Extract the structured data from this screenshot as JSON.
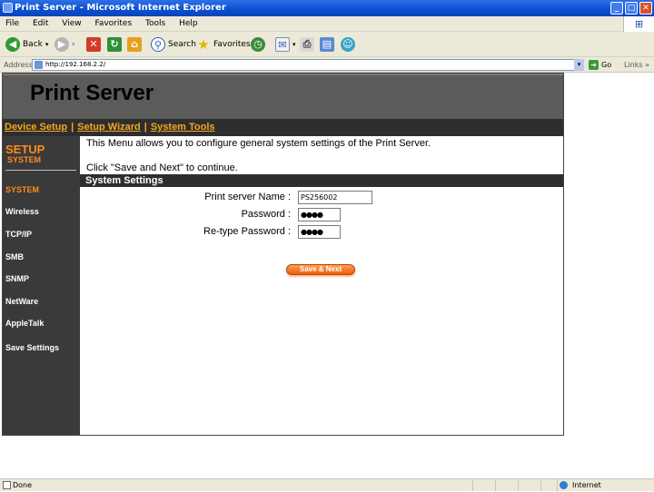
{
  "window": {
    "title": "Print Server - Microsoft Internet Explorer",
    "min": "_",
    "max": "□",
    "close": "✕"
  },
  "menu": [
    "File",
    "Edit",
    "View",
    "Favorites",
    "Tools",
    "Help"
  ],
  "toolbar": {
    "back": "Back",
    "search": "Search",
    "favorites": "Favorites"
  },
  "address": {
    "label": "Address",
    "url": "http://192.168.2.2/",
    "go": "Go",
    "links": "Links"
  },
  "page": {
    "title": "Print Server",
    "nav": [
      "Device Setup",
      "Setup Wizard",
      "System Tools"
    ],
    "nav_sep": "|",
    "sidebar": {
      "heading": "SETUP",
      "subheading": "SYSTEM",
      "items": [
        "SYSTEM",
        "Wireless",
        "TCP/IP",
        "SMB",
        "SNMP",
        "NetWare",
        "AppleTalk",
        "Save Settings"
      ]
    },
    "intro": "This Menu allows you to configure general system settings of the Print Server.",
    "instruction": "Click \"Save and Next\" to continue.",
    "section_title": "System Settings",
    "fields": [
      {
        "label": "Print server Name :",
        "value": "PS256002"
      },
      {
        "label": "Password :",
        "value": "●●●●"
      },
      {
        "label": "Re-type Password :",
        "value": "●●●●"
      }
    ],
    "save_button": "Save & Next"
  },
  "status": {
    "text": "Done",
    "zone": "Internet"
  },
  "colors": {
    "accent_orange": "#f5a623",
    "header_gray": "#5b5b5b",
    "bar_dark": "#2e2e2e",
    "sidebar": "#3a3a3a"
  }
}
